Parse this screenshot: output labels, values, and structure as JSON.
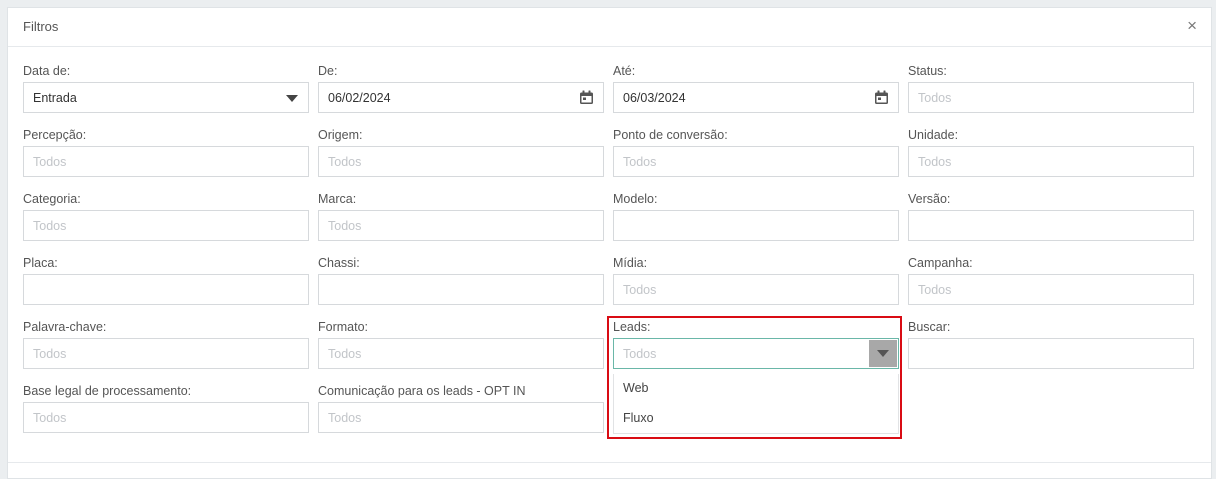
{
  "panel": {
    "title": "Filtros",
    "close_label": "×"
  },
  "fields": {
    "data_de": {
      "label": "Data de:",
      "value": "Entrada"
    },
    "de": {
      "label": "De:",
      "value": "06/02/2024"
    },
    "ate": {
      "label": "Até:",
      "value": "06/03/2024"
    },
    "status": {
      "label": "Status:",
      "placeholder": "Todos"
    },
    "percepcao": {
      "label": "Percepção:",
      "placeholder": "Todos"
    },
    "origem": {
      "label": "Origem:",
      "placeholder": "Todos"
    },
    "ponto": {
      "label": "Ponto de conversão:",
      "placeholder": "Todos"
    },
    "unidade": {
      "label": "Unidade:",
      "placeholder": "Todos"
    },
    "categoria": {
      "label": "Categoria:",
      "placeholder": "Todos"
    },
    "marca": {
      "label": "Marca:",
      "placeholder": "Todos"
    },
    "modelo": {
      "label": "Modelo:",
      "placeholder": ""
    },
    "versao": {
      "label": "Versão:",
      "placeholder": ""
    },
    "placa": {
      "label": "Placa:",
      "placeholder": ""
    },
    "chassi": {
      "label": "Chassi:",
      "placeholder": ""
    },
    "midia": {
      "label": "Mídia:",
      "placeholder": "Todos"
    },
    "campanha": {
      "label": "Campanha:",
      "placeholder": "Todos"
    },
    "palavra": {
      "label": "Palavra-chave:",
      "placeholder": "Todos"
    },
    "formato": {
      "label": "Formato:",
      "placeholder": "Todos"
    },
    "leads": {
      "label": "Leads:",
      "placeholder": "Todos",
      "options": [
        "Web",
        "Fluxo"
      ]
    },
    "buscar": {
      "label": "Buscar:",
      "placeholder": ""
    },
    "base_legal": {
      "label": "Base legal de processamento:",
      "placeholder": "Todos"
    },
    "comunicacao": {
      "label": "Comunicação para os leads - OPT IN",
      "placeholder": "Todos"
    }
  },
  "icons": {
    "calendar": "calendar-icon",
    "dropdown": "chevron-down-icon",
    "close": "close-icon"
  },
  "colors": {
    "highlight": "#d90c14",
    "focus_border": "#6ab7a8"
  }
}
